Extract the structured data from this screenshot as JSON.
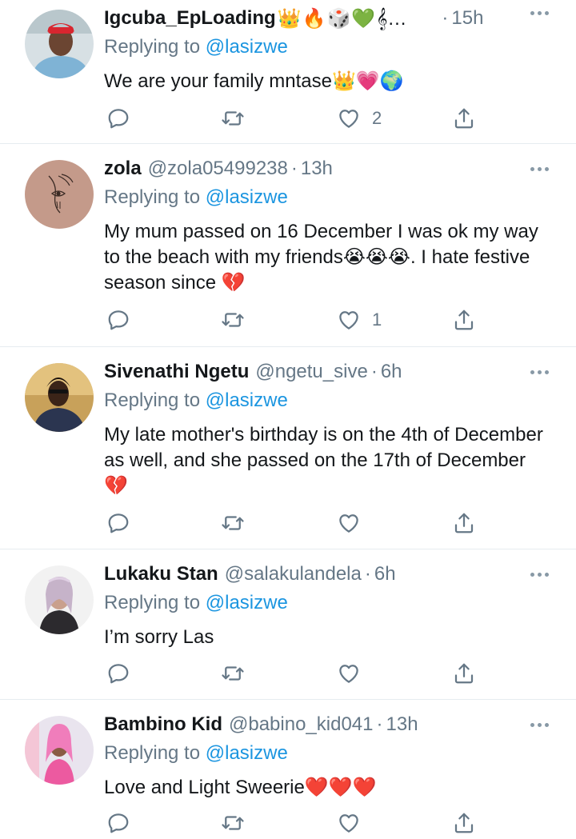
{
  "colors": {
    "link": "#1b95e0",
    "muted": "#657786",
    "divider": "#e6ecf0",
    "icon": "#657786"
  },
  "icons": {
    "reply": "speech-bubble-icon",
    "retweet": "retweet-icon",
    "like": "heart-icon",
    "share": "share-icon",
    "more": "more-dots-icon"
  },
  "tweets": [
    {
      "name": "Igcuba_EpLoading",
      "name_emoji": "👑🔥🎲💚𝄞...",
      "handle": "",
      "time": "15h",
      "reply_prefix": "Replying to ",
      "reply_to": "@lasizwe",
      "text": "We are your family mntase👑💗🌍",
      "like_count": "2"
    },
    {
      "name": "zola",
      "handle": "@zola05499238",
      "time": "13h",
      "reply_prefix": "Replying to ",
      "reply_to": "@lasizwe",
      "text": "My mum passed on 16 December I was ok my way to the beach with my friends😭😭😭. I hate festive season since 💔",
      "like_count": "1"
    },
    {
      "name": "Sivenathi Ngetu",
      "handle": "@ngetu_sive",
      "time": "6h",
      "reply_prefix": "Replying to ",
      "reply_to": "@lasizwe",
      "text": "My late mother's birthday is on the 4th of December as well, and she passed on the 17th of December 💔",
      "like_count": ""
    },
    {
      "name": "Lukaku Stan",
      "handle": "@salakulandela",
      "time": "6h",
      "reply_prefix": "Replying to ",
      "reply_to": "@lasizwe",
      "text": "I’m sorry Las",
      "like_count": ""
    },
    {
      "name": "Bambino Kid",
      "handle": "@babino_kid041",
      "time": "13h",
      "reply_prefix": "Replying to ",
      "reply_to": "@lasizwe",
      "text": "Love and Light Sweerie❤️❤️❤️",
      "like_count": ""
    }
  ]
}
